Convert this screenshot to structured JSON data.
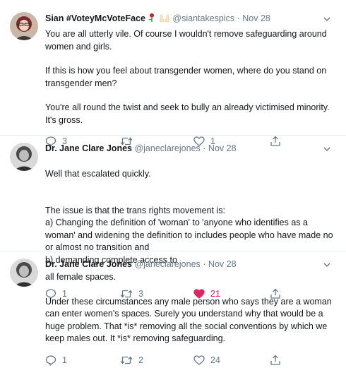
{
  "tweets": [
    {
      "name": "Sian #VoteyMcVoteFace",
      "handle": "@siantakespics",
      "separator": "·",
      "time": "Nov 28",
      "paragraphs": [
        "You are all utterly vile. Of course I wouldn't remove safeguarding around women and girls.",
        "If this is how you feel about transgender women, where do you stand on transgender men?",
        "You're all round the twist and seek to bully an already victimised minority. It's gross."
      ],
      "replies": "3",
      "retweets": "",
      "likes": "1",
      "liked": false,
      "icons": [
        "rose-emoji-icon",
        "raised-hands-emoji-icon"
      ]
    },
    {
      "name": "Dr. Jane Clare Jones",
      "handle": "@janeclarejones",
      "separator": "·",
      "time": "Nov 28",
      "paragraphs": [
        "Well that escalated quickly.",
        "The issue is that the trans rights movement is:\na) Changing the definition of 'woman' to 'anyone who identifies as a woman' and widening the definition to includes people who have made no or almost no transition and\nb) demanding complete access to"
      ],
      "replies": "1",
      "retweets": "3",
      "likes": "21",
      "liked": true
    },
    {
      "name": "Dr. Jane Clare Jones",
      "handle": "@janeclarejones",
      "separator": "·",
      "time": "Nov 28",
      "paragraphs": [
        "all female spaces.",
        "Under these circumstances any male person who says they are a woman can enter women's spaces. Surely you understand why that would be a huge problem. That *is* removing all the social conventions by which we keep males out. It *is* removing safeguarding."
      ],
      "replies": "1",
      "retweets": "2",
      "likes": "24",
      "liked": false
    }
  ],
  "colors": {
    "text": "#14171a",
    "muted": "#657786",
    "like_active": "#e0245e",
    "divider": "#e6ecf0"
  }
}
